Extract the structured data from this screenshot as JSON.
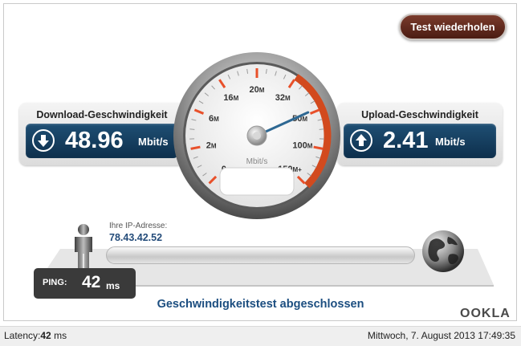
{
  "retest_button": "Test wiederholen",
  "download": {
    "label": "Download-Geschwindigkeit",
    "value": "48.96",
    "unit": "Mbit/s"
  },
  "upload": {
    "label": "Upload-Geschwindigkeit",
    "value": "2.41",
    "unit": "Mbit/s"
  },
  "gauge": {
    "unit_label": "Mbit/s",
    "ticks": [
      {
        "v": "0",
        "s": ""
      },
      {
        "v": "2",
        "s": "M"
      },
      {
        "v": "6",
        "s": "M"
      },
      {
        "v": "16",
        "s": "M"
      },
      {
        "v": "20",
        "s": "M"
      },
      {
        "v": "32",
        "s": "M"
      },
      {
        "v": "50",
        "s": "M"
      },
      {
        "v": "100",
        "s": "M"
      },
      {
        "v": "150",
        "s": "M+"
      }
    ],
    "needle_value_mbits": 48.96
  },
  "ip": {
    "label": "Ihre IP-Adresse:",
    "value": "78.43.42.52"
  },
  "ping": {
    "label": "PING:",
    "value": "42",
    "unit": "ms"
  },
  "status": "Geschwindigkeitstest abgeschlossen",
  "brand": "OOKLA",
  "footer": {
    "latency_label": "Latency:",
    "latency_value": "42",
    "latency_unit": " ms",
    "datetime": "Mittwoch, 7. August 2013 17:49:35"
  }
}
